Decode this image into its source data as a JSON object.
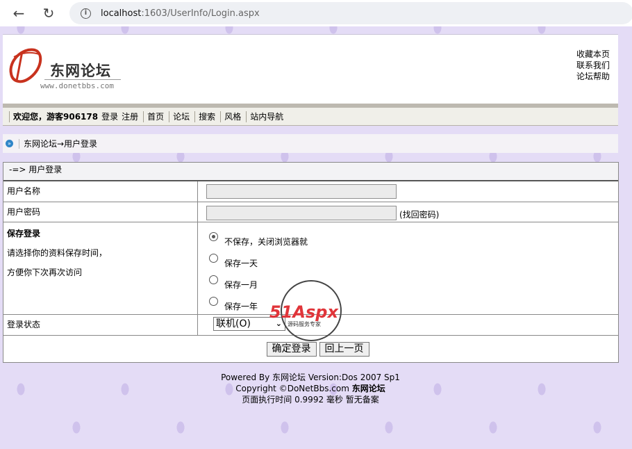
{
  "browser": {
    "url_host": "localhost",
    "url_path": ":1603/UserInfo/Login.aspx"
  },
  "header": {
    "logo_title": "东网论坛",
    "logo_domain": "www.donetbbs.com",
    "links": [
      "收藏本页",
      "联系我们",
      "论坛帮助"
    ]
  },
  "menu": {
    "welcome": "欢迎您，游客906178",
    "login": "登录",
    "register": "注册",
    "items": [
      "首页",
      "论坛",
      "搜索",
      "风格",
      "站内导航"
    ]
  },
  "breadcrumb": {
    "text": "东网论坛→用户登录"
  },
  "login_box": {
    "title": "-=> 用户登录",
    "username_label": "用户名称",
    "password_label": "用户密码",
    "find_password": "(找回密码)",
    "save_title": "保存登录",
    "save_desc1": "请选择你的资料保存时间，",
    "save_desc2": "方便你下次再次访问",
    "save_options": [
      "不保存，关闭浏览器就",
      "保存一天",
      "保存一月",
      "保存一年"
    ],
    "state_label": "登录状态",
    "state_value": "联机(O)",
    "submit": "确定登录",
    "back": "回上一页"
  },
  "footer": {
    "line1_prefix": "Powered By ",
    "line1_brand": "东网论坛",
    "line1_suffix": " Version:Dos 2007 Sp1",
    "line2_prefix": "Copyright ©DoNetBbs.com ",
    "line2_brand": "东网论坛",
    "line3": "页面执行时间 0.9992 毫秒  暂无备案"
  },
  "watermark": {
    "brand": "51Aspx",
    "tagline": "源码服务专家"
  }
}
